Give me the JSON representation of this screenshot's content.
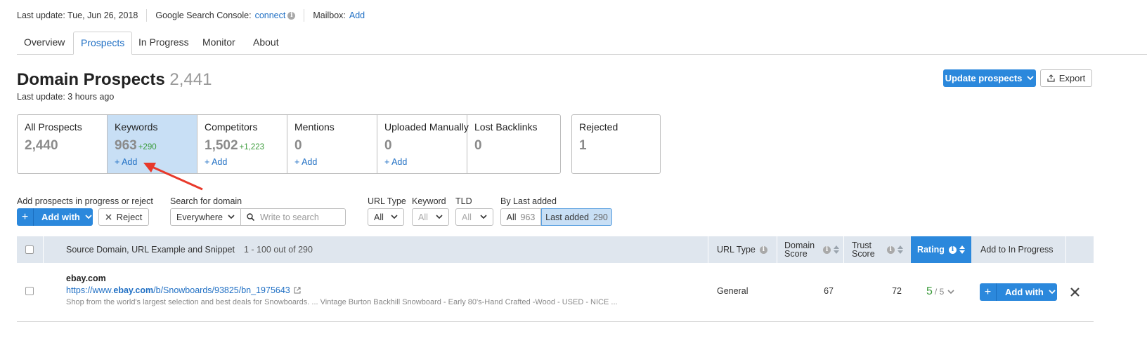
{
  "topbar": {
    "last_update": "Last update: Tue, Jun 26, 2018",
    "gsc_label": "Google Search Console:",
    "gsc_link": "connect",
    "mailbox_label": "Mailbox:",
    "mailbox_link": "Add"
  },
  "tabs": [
    "Overview",
    "Prospects",
    "In Progress",
    "Monitor",
    "About"
  ],
  "active_tab": "Prospects",
  "header": {
    "title": "Domain Prospects",
    "count": "2,441",
    "subtitle": "Last update: 3 hours ago",
    "update_button": "Update prospects",
    "export_button": "Export"
  },
  "cards": [
    {
      "title": "All Prospects",
      "value": "2,440",
      "delta": "",
      "add": ""
    },
    {
      "title": "Keywords",
      "value": "963",
      "delta": "+290",
      "add": "+ Add"
    },
    {
      "title": "Competitors",
      "value": "1,502",
      "delta": "+1,223",
      "add": "+ Add"
    },
    {
      "title": "Mentions",
      "value": "0",
      "delta": "",
      "add": "+ Add"
    },
    {
      "title": "Uploaded Manually",
      "value": "0",
      "delta": "",
      "add": "+ Add"
    },
    {
      "title": "Lost Backlinks",
      "value": "0",
      "delta": "",
      "add": ""
    }
  ],
  "rejected_card": {
    "title": "Rejected",
    "value": "1"
  },
  "filters": {
    "add_label": "Add prospects in progress or reject",
    "add_with": "Add with",
    "reject": "Reject",
    "search_label": "Search for domain",
    "search_scope": "Everywhere",
    "search_placeholder": "Write to search",
    "url_type_label": "URL Type",
    "url_type_value": "All",
    "keyword_label": "Keyword",
    "keyword_value": "All",
    "tld_label": "TLD",
    "tld_value": "All",
    "by_last_added_label": "By Last added",
    "all_label": "All",
    "all_count": "963",
    "last_added_label": "Last added",
    "last_added_count": "290"
  },
  "table": {
    "col_source": "Source Domain, URL Example and Snippet",
    "range": "1 - 100 out of 290",
    "col_url_type": "URL Type",
    "col_domain_score_1": "Domain",
    "col_domain_score_2": "Score",
    "col_trust_score_1": "Trust",
    "col_trust_score_2": "Score",
    "col_rating": "Rating",
    "col_add": "Add to In Progress",
    "rows": [
      {
        "domain": "ebay.com",
        "url_prefix": "https://www.",
        "url_domain": "ebay.com",
        "url_path": "/b/Snowboards/93825/bn_1975643",
        "snippet": "Shop from the world's largest selection and best deals for Snowboards. ... Vintage Burton Backhill Snowboard - Early 80's-Hand Crafted -Wood - USED - NICE ...",
        "url_type": "General",
        "domain_score": "67",
        "trust_score": "72",
        "rating": "5",
        "rating_max": "/ 5",
        "add_with": "Add with"
      }
    ]
  },
  "colors": {
    "primary": "#2b88dc",
    "link": "#1f6fc4",
    "delta_green": "#3a9b3a",
    "annotation_arrow": "#e8392b"
  }
}
